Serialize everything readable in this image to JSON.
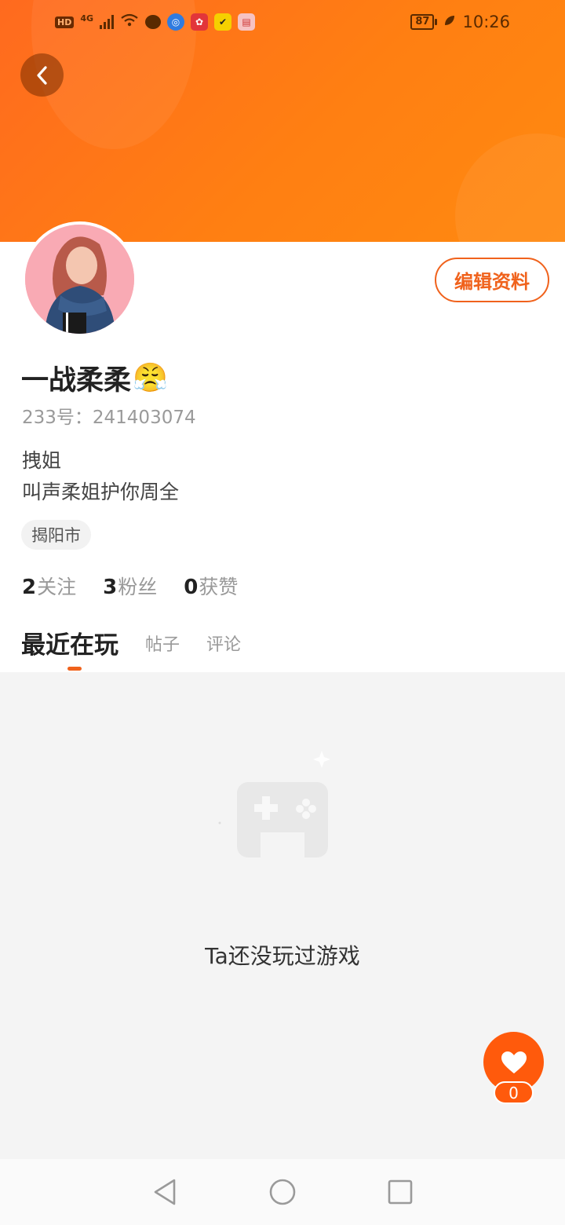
{
  "status_bar": {
    "hd": "HD",
    "network": "4G",
    "battery": "87",
    "time": "10:26"
  },
  "profile": {
    "nickname": "一战柔柔",
    "emoji": "😤",
    "id_line": "233号：241403074",
    "bio_lines": [
      "拽姐",
      "叫声柔姐护你周全"
    ],
    "location": "揭阳市",
    "edit_button": "编辑资料"
  },
  "stats": [
    {
      "num": "2",
      "label": "关注"
    },
    {
      "num": "3",
      "label": "粉丝"
    },
    {
      "num": "0",
      "label": "获赞"
    }
  ],
  "tabs": [
    {
      "label": "最近在玩",
      "active": true
    },
    {
      "label": "帖子",
      "active": false
    },
    {
      "label": "评论",
      "active": false
    }
  ],
  "empty_state": {
    "text": "Ta还没玩过游戏"
  },
  "like_fab": {
    "count": "0"
  },
  "colors": {
    "accent": "#f0621c",
    "banner": "#ff7612",
    "fab": "#ff5a0c"
  }
}
